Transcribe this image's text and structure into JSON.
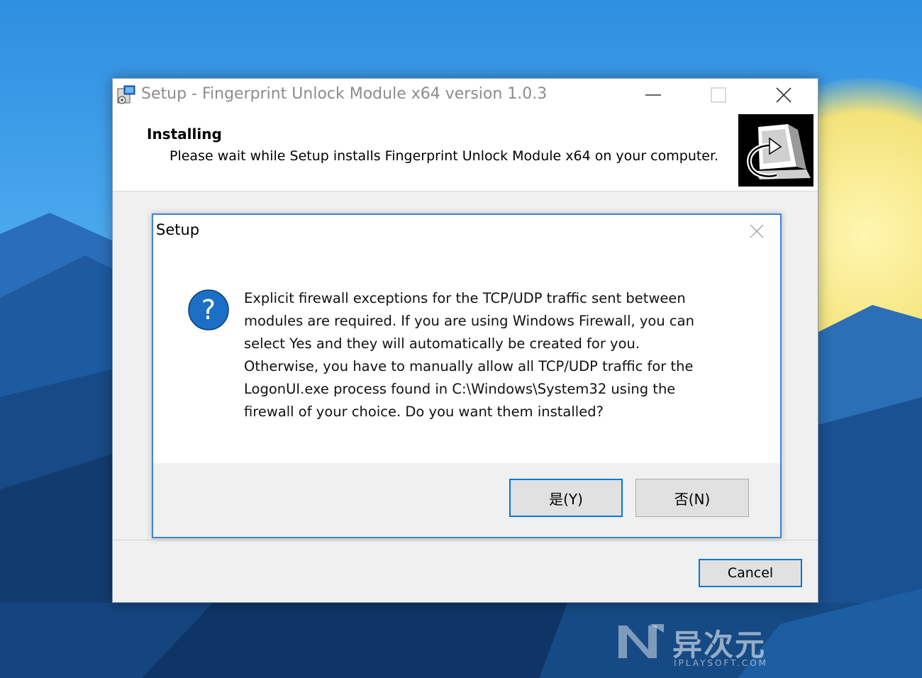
{
  "desktop": {
    "watermark": {
      "main": "异次元",
      "sub": "IPLAYSOFT.COM"
    }
  },
  "setup_window": {
    "title": "Setup - Fingerprint Unlock Module x64 version 1.0.3",
    "header_title": "Installing",
    "header_subtitle": "Please wait while Setup installs Fingerprint Unlock Module x64 on your computer.",
    "cancel_label": "Cancel"
  },
  "dialog": {
    "title": "Setup",
    "lines": [
      "Explicit firewall exceptions for the TCP/UDP traffic sent between",
      "modules are required. If you are using Windows Firewall, you can",
      "select Yes and they will automatically be created for you.",
      "Otherwise, you have to manually allow all TCP/UDP traffic for the",
      "LogonUI.exe process found in C:\\Windows\\System32 using the",
      "firewall of your choice. Do you want them installed?"
    ],
    "yes_label": "是(Y)",
    "no_label": "否(N)",
    "icon": "question-icon"
  },
  "colors": {
    "accent": "#0078d7",
    "question_icon": "#1c6fc4"
  }
}
